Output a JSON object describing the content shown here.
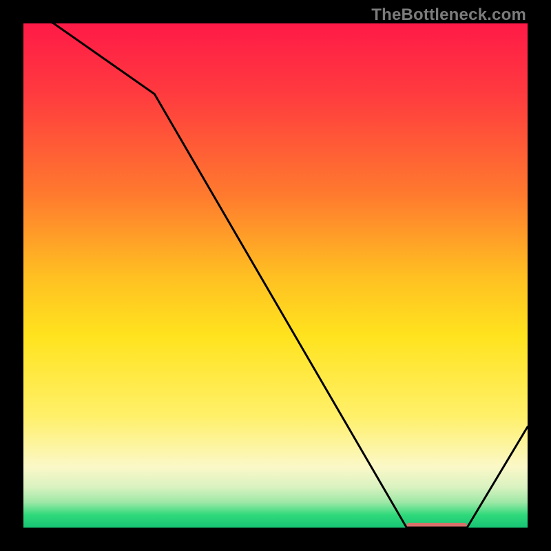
{
  "watermark": "TheBottleneck.com",
  "chart_data": {
    "type": "line",
    "title": "",
    "xlabel": "",
    "ylabel": "",
    "xlim": [
      0,
      100
    ],
    "ylim": [
      0,
      100
    ],
    "x": [
      0,
      6,
      26,
      76,
      82,
      88,
      100
    ],
    "values": [
      108,
      100,
      86,
      0,
      0,
      0,
      20
    ],
    "optimal_band": {
      "x_start": 76,
      "x_end": 88,
      "y": 0
    },
    "gradient_stops": [
      {
        "pct": 0,
        "color": "#ff1a47"
      },
      {
        "pct": 14,
        "color": "#ff3b3f"
      },
      {
        "pct": 34,
        "color": "#ff7a2e"
      },
      {
        "pct": 50,
        "color": "#ffbf22"
      },
      {
        "pct": 62,
        "color": "#ffe31e"
      },
      {
        "pct": 78,
        "color": "#fff06a"
      },
      {
        "pct": 88,
        "color": "#fbf8c8"
      },
      {
        "pct": 92,
        "color": "#d9f2c0"
      },
      {
        "pct": 95,
        "color": "#9de8a6"
      },
      {
        "pct": 97.5,
        "color": "#2fd97b"
      },
      {
        "pct": 100,
        "color": "#17c474"
      }
    ],
    "optimal_marker_color": "#d9706b"
  }
}
